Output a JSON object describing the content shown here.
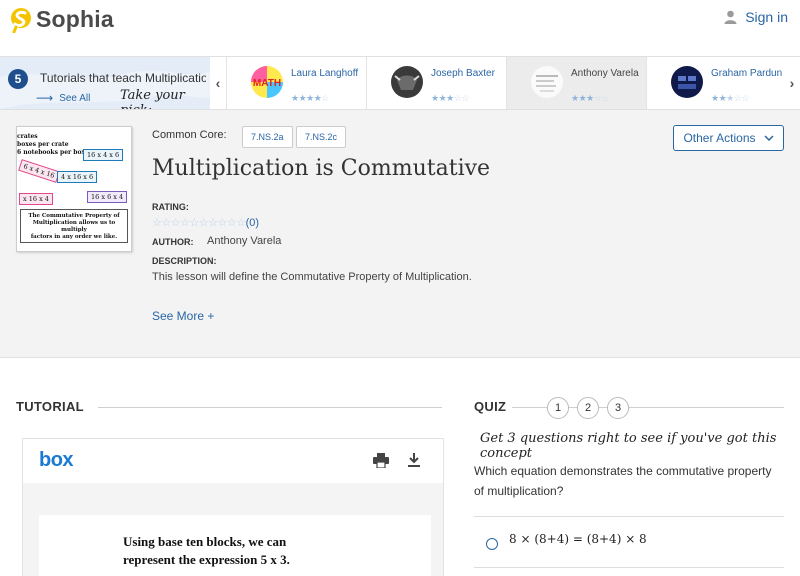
{
  "header": {
    "brand": "Sophia",
    "signin_label": "Sign in"
  },
  "tutorials_bar": {
    "count": "5",
    "title": "Tutorials that teach Multiplication is Commutative",
    "see_all": "See All",
    "pick_text": "Take your pick:",
    "cards": [
      {
        "author": "Laura Langhoff",
        "rating": 4,
        "thumb": "math-icon"
      },
      {
        "author": "Joseph Baxter",
        "rating": 3,
        "thumb": "bull-icon"
      },
      {
        "author": "Anthony Varela",
        "rating": 3,
        "thumb": "document-icon"
      },
      {
        "author": "Graham Pardun",
        "rating": 2.5,
        "thumb": "diagram-icon"
      }
    ]
  },
  "lesson": {
    "common_core_label": "Common Core:",
    "tags": [
      "7.NS.2a",
      "7.NS.2c"
    ],
    "title": "Multiplication is Commutative",
    "other_actions": "Other Actions",
    "rating_label": "RATING:",
    "rating_count": "(0)",
    "author_label": "AUTHOR:",
    "author": "Anthony Varela",
    "description_label": "DESCRIPTION:",
    "description": "This lesson will define the Commutative Property of Multiplication.",
    "see_more": "See More +",
    "thumbnail": {
      "line1": "crates",
      "line2": "boxes per crate",
      "line3": "6 notebooks per box",
      "expr1": "16 x 4 x 6",
      "expr2": "6 x 4 x 16",
      "expr3": "4 x 16 x 6",
      "expr4": "x 16 x 4",
      "expr5": "16 x 6 x 4",
      "caption1": "The Commutative Property of",
      "caption2": "Multiplication allows us to multiply",
      "caption3": "factors in any order we like."
    }
  },
  "tutorial": {
    "heading": "TUTORIAL",
    "viewer_brand": "box",
    "page_text_line1": "Using base ten blocks, we can",
    "page_text_line2": "represent the expression 5 x 3."
  },
  "quiz": {
    "heading": "QUIZ",
    "steps": [
      "1",
      "2",
      "3"
    ],
    "hint": "Get 3 questions right to see if you've got this concept",
    "question": "Which equation demonstrates the commutative property of multiplication?",
    "option1": "8 × (8+4) = (8+4) × 8"
  },
  "colors": {
    "link": "#2966a5",
    "brand_yellow": "#f5c400",
    "panel_bg": "#f3f3f3"
  }
}
